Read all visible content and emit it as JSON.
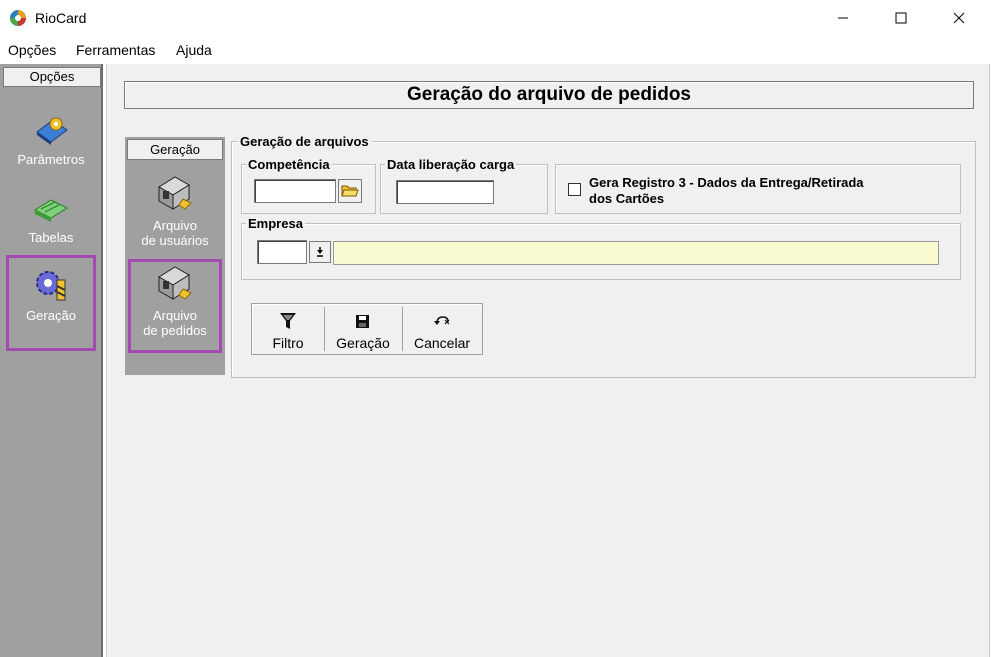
{
  "window": {
    "title": "RioCard",
    "icon": "riocard-logo-icon"
  },
  "menu": {
    "items": [
      "Opções",
      "Ferramentas",
      "Ajuda"
    ]
  },
  "left_panel": {
    "header": "Opções",
    "items": [
      {
        "label": "Parâmetros",
        "icon": "parametros-icon"
      },
      {
        "label": "Tabelas",
        "icon": "tabelas-icon"
      },
      {
        "label": "Geração",
        "icon": "geracao-gear-icon"
      }
    ]
  },
  "main": {
    "title": "Geração do arquivo de pedidos"
  },
  "sub_panel": {
    "header": "Geração",
    "items": [
      {
        "line1": "Arquivo",
        "line2": "de usuários",
        "icon": "arquivo-icon"
      },
      {
        "line1": "Arquivo",
        "line2": "de pedidos",
        "icon": "arquivo-icon"
      }
    ]
  },
  "form": {
    "group_title": "Geração de arquivos",
    "competencia": {
      "label": "Competência",
      "value": ""
    },
    "data_liberacao": {
      "label": "Data liberação carga",
      "value": ""
    },
    "gera_registro": {
      "line1": "Gera Registro 3 - Dados da Entrega/Retirada",
      "line2": "dos Cartões",
      "checked": false
    },
    "empresa": {
      "label": "Empresa",
      "code": "",
      "name": ""
    }
  },
  "toolbar": {
    "filtro": "Filtro",
    "geracao": "Geração",
    "cancelar": "Cancelar"
  }
}
